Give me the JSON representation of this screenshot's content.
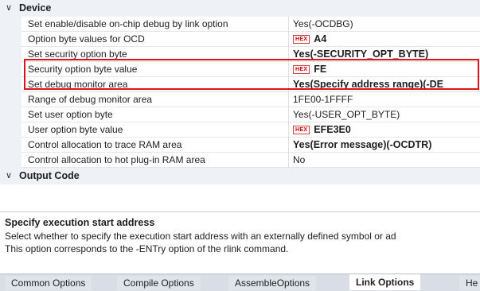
{
  "categories": {
    "device": "Device",
    "output_code": "Output Code"
  },
  "properties": [
    {
      "name": "Set enable/disable on-chip debug by link option",
      "value": "Yes(-OCDBG)",
      "hex": false,
      "bold": false
    },
    {
      "name": "Option byte values for OCD",
      "value": "A4",
      "hex": true,
      "bold": true
    },
    {
      "name": "Set security option byte",
      "value": "Yes(-SECURITY_OPT_BYTE)",
      "hex": false,
      "bold": true
    },
    {
      "name": "Security option byte value",
      "value": "FE",
      "hex": true,
      "bold": true
    },
    {
      "name": "Set debug monitor area",
      "value": "Yes(Specify address range)(-DE",
      "hex": false,
      "bold": true
    },
    {
      "name": "Range of debug monitor area",
      "value": "1FE00-1FFFF",
      "hex": false,
      "bold": false
    },
    {
      "name": "Set user option byte",
      "value": "Yes(-USER_OPT_BYTE)",
      "hex": false,
      "bold": false
    },
    {
      "name": "User option byte value",
      "value": "EFE3E0",
      "hex": true,
      "bold": true
    },
    {
      "name": "Control allocation to trace RAM area",
      "value": "Yes(Error message)(-OCDTR)",
      "hex": false,
      "bold": true
    },
    {
      "name": "Control allocation to hot plug-in RAM area",
      "value": "No",
      "hex": false,
      "bold": false
    }
  ],
  "hex_badge": "HEX",
  "description": {
    "title": "Specify execution start address",
    "line1": "Select whether to specify the execution start address with an externally defined symbol or ad",
    "line2": "This option corresponds to the -ENTry option of the rlink command."
  },
  "tabs": [
    {
      "label": "Common Options",
      "active": false
    },
    {
      "label": "Compile Options",
      "active": false
    },
    {
      "label": "AssembleOptions",
      "active": false
    },
    {
      "label": "Link Options",
      "active": true
    },
    {
      "label": "He",
      "active": false
    }
  ],
  "colors": {
    "highlight": "#e0121a",
    "hex_badge": "#c00000",
    "category_bg": "#eef1f6"
  },
  "icons": {
    "expand": "chevron-down-icon"
  }
}
